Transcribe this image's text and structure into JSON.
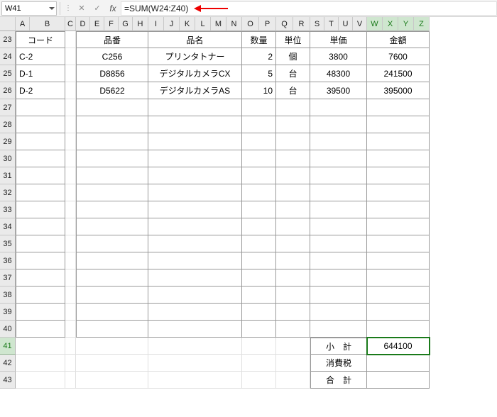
{
  "formulaBar": {
    "cellRef": "W41",
    "formula": "=SUM(W24:Z40)"
  },
  "columns": [
    "A",
    "B",
    "C",
    "D",
    "E",
    "F",
    "G",
    "H",
    "I",
    "J",
    "K",
    "L",
    "M",
    "N",
    "O",
    "P",
    "Q",
    "R",
    "S",
    "T",
    "U",
    "V",
    "W",
    "X",
    "Y",
    "Z"
  ],
  "selectedCols": [
    "W",
    "X",
    "Y",
    "Z"
  ],
  "rowNumbers": [
    23,
    24,
    25,
    26,
    27,
    28,
    29,
    30,
    31,
    32,
    33,
    34,
    35,
    36,
    37,
    38,
    39,
    40,
    41,
    42,
    43
  ],
  "selectedRow": 41,
  "headers": {
    "code": "コード",
    "partNo": "品番",
    "partName": "品名",
    "qty": "数量",
    "unit": "単位",
    "unitPrice": "単価",
    "amount": "金額"
  },
  "tableRows": [
    {
      "code": "C-2",
      "partNo": "C256",
      "partName": "プリンタトナー",
      "qty": "2",
      "unit": "個",
      "unitPrice": "3800",
      "amount": "7600"
    },
    {
      "code": "D-1",
      "partNo": "D8856",
      "partName": "デジタルカメラCX",
      "qty": "5",
      "unit": "台",
      "unitPrice": "48300",
      "amount": "241500"
    },
    {
      "code": "D-2",
      "partNo": "D5622",
      "partName": "デジタルカメラAS",
      "qty": "10",
      "unit": "台",
      "unitPrice": "39500",
      "amount": "395000"
    }
  ],
  "summary": {
    "subtotalLabel": "小　計",
    "subtotalValue": "644100",
    "taxLabel": "消費税",
    "totalLabel": "合　計"
  }
}
